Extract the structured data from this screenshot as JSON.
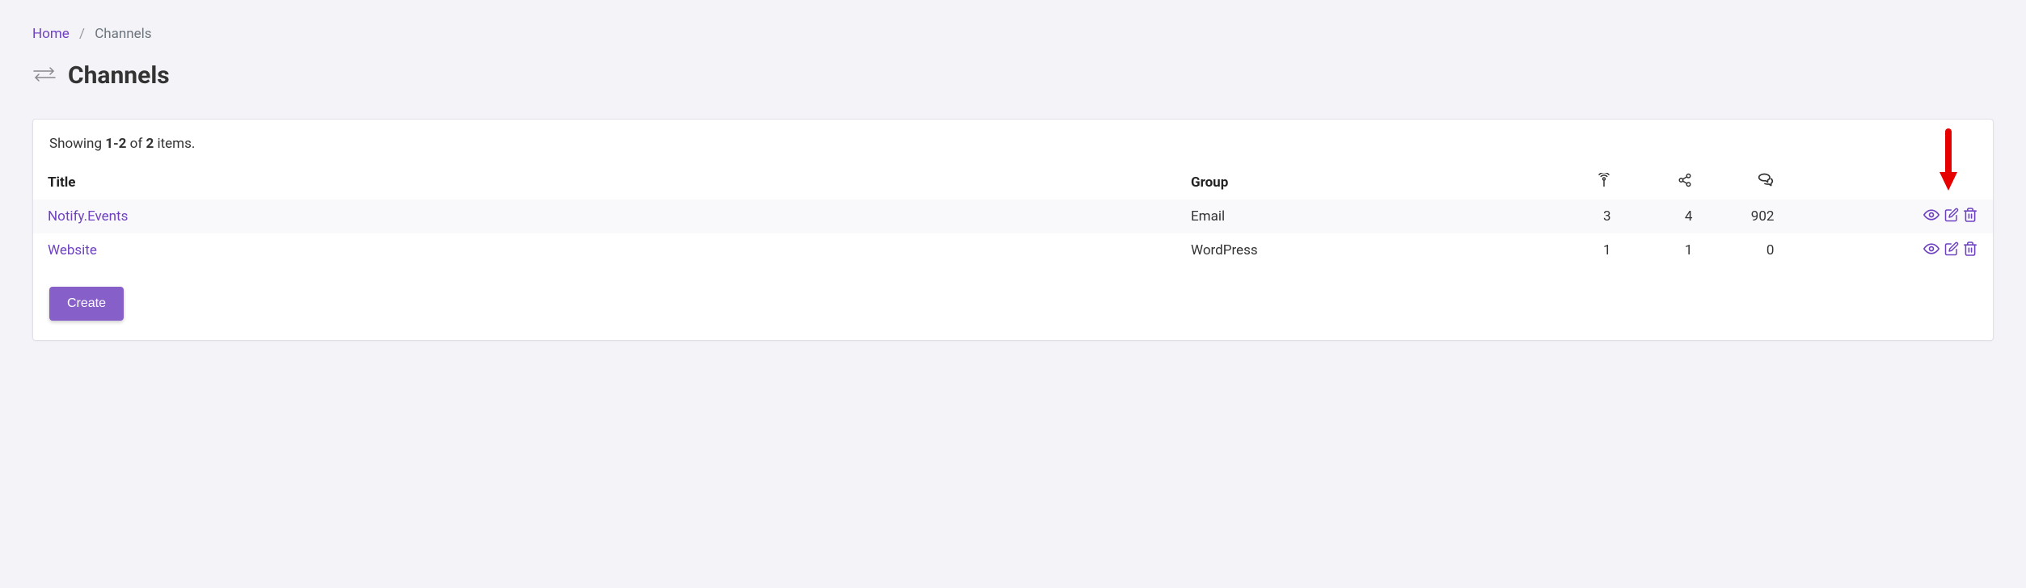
{
  "breadcrumb": {
    "home": "Home",
    "current": "Channels"
  },
  "page": {
    "title": "Channels"
  },
  "showing": {
    "prefix": "Showing ",
    "range": "1-2",
    "mid": " of ",
    "total": "2",
    "suffix": " items."
  },
  "columns": {
    "title": "Title",
    "group": "Group"
  },
  "rows": [
    {
      "title": "Notify.Events",
      "group": "Email",
      "c1": "3",
      "c2": "4",
      "c3": "902"
    },
    {
      "title": "Website",
      "group": "WordPress",
      "c1": "1",
      "c2": "1",
      "c3": "0"
    }
  ],
  "buttons": {
    "create": "Create"
  }
}
